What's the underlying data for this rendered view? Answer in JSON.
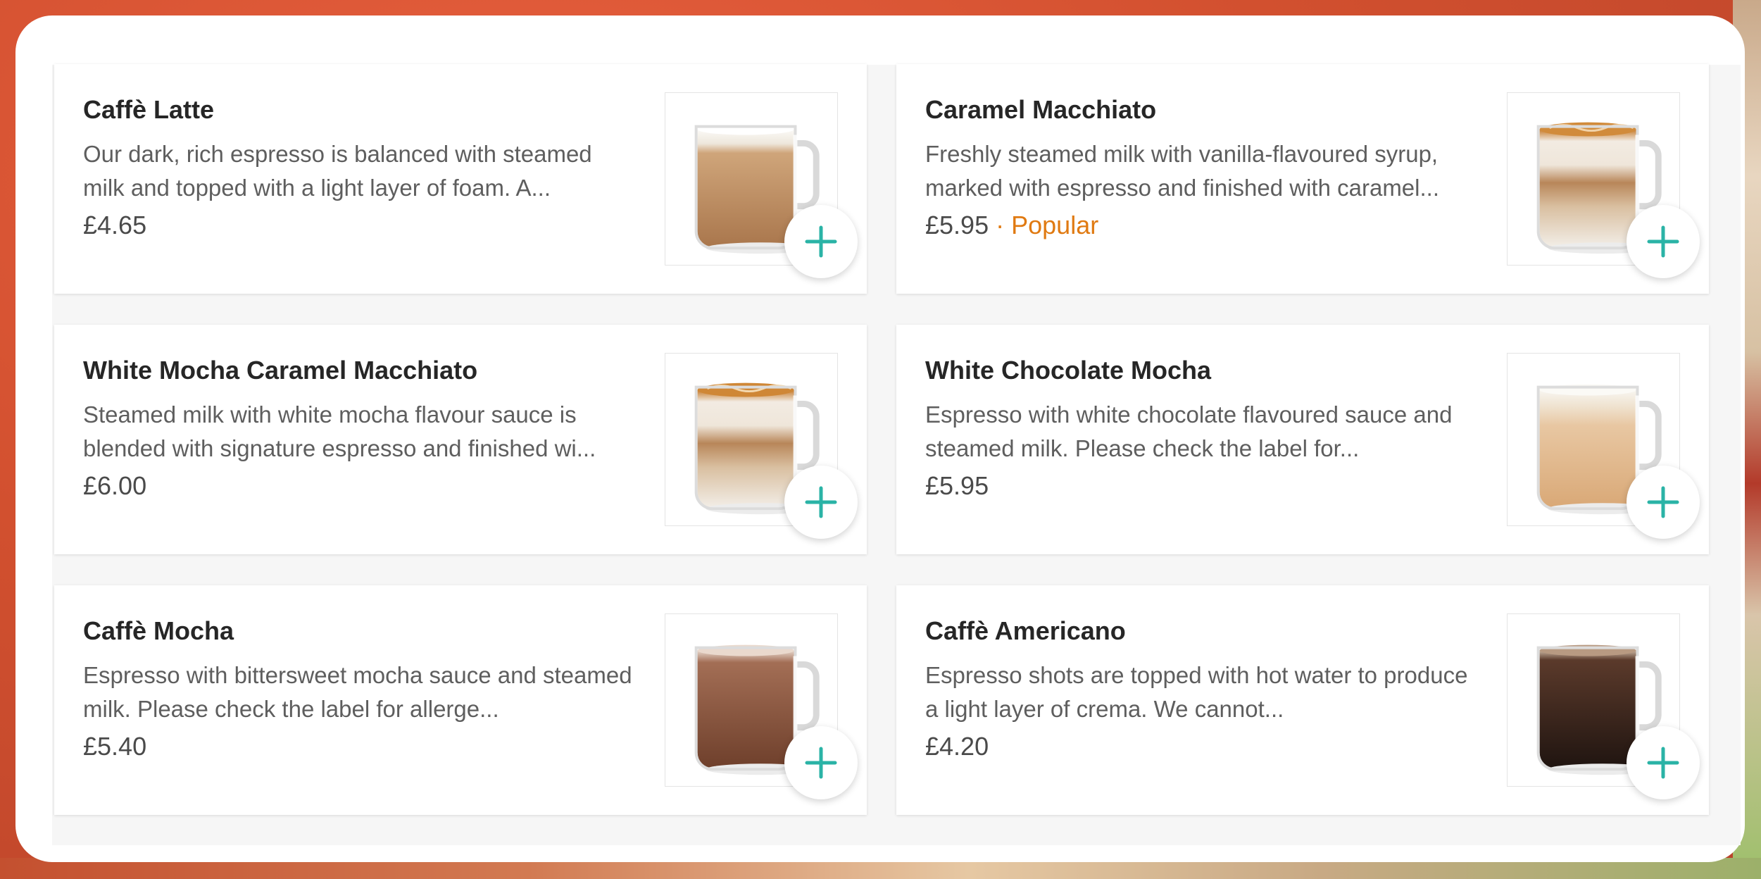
{
  "colors": {
    "accent": "#2ab3a6",
    "popular": "#e07a12",
    "title": "#262626",
    "body": "#5e5e5e",
    "background": "#d2502f"
  },
  "items": [
    {
      "name": "Caffè Latte",
      "description": "Our dark, rich espresso is balanced with steamed milk and topped with a light layer of foam. A...",
      "price": "£4.65",
      "tag": "",
      "image": "latte-mug-icon",
      "add_icon": "plus-icon"
    },
    {
      "name": "Caramel Macchiato",
      "description": "Freshly steamed milk with vanilla-flavoured syrup, marked with espresso and finished with caramel...",
      "price": "£5.95",
      "tag_separator": "·",
      "tag": "Popular",
      "image": "caramel-macchiato-mug-icon",
      "add_icon": "plus-icon"
    },
    {
      "name": "White Mocha Caramel Macchiato",
      "description": "Steamed milk with white mocha flavour sauce is blended with signature espresso and finished wi...",
      "price": "£6.00",
      "tag": "",
      "image": "white-mocha-caramel-mug-icon",
      "add_icon": "plus-icon"
    },
    {
      "name": "White Chocolate Mocha",
      "description": "Espresso with white chocolate flavoured sauce and steamed milk. Please check the label for...",
      "price": "£5.95",
      "tag": "",
      "image": "white-chocolate-mocha-mug-icon",
      "add_icon": "plus-icon"
    },
    {
      "name": "Caffè Mocha",
      "description": "Espresso with bittersweet mocha sauce and steamed milk. Please check the label for allerge...",
      "price": "£5.40",
      "tag": "",
      "image": "mocha-mug-icon",
      "add_icon": "plus-icon"
    },
    {
      "name": "Caffè Americano",
      "description": "Espresso shots are topped with hot water to produce a light layer of crema. We cannot...",
      "price": "£4.20",
      "tag": "",
      "image": "americano-mug-icon",
      "add_icon": "plus-icon"
    }
  ]
}
